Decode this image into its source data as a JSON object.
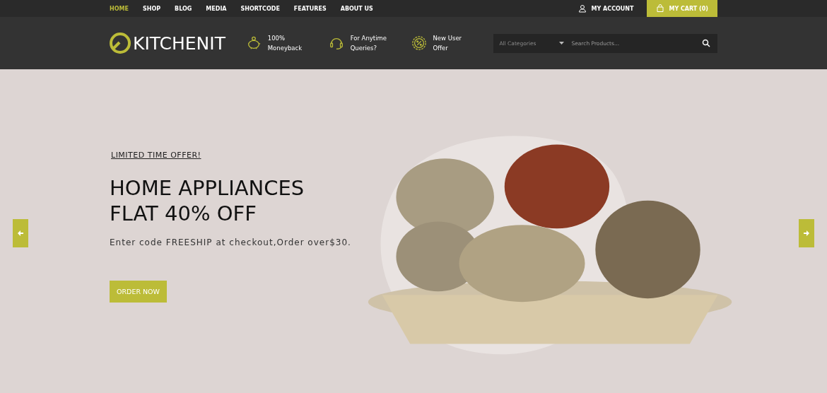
{
  "nav": [
    {
      "label": "HOME",
      "selected": true
    },
    {
      "label": "SHOP",
      "selected": false
    },
    {
      "label": "BLOG",
      "selected": false
    },
    {
      "label": "MEDIA",
      "selected": false
    },
    {
      "label": "SHORTCODE",
      "selected": false
    },
    {
      "label": "FEATURES",
      "selected": false
    },
    {
      "label": "ABOUT US",
      "selected": false
    }
  ],
  "account": "MY ACCOUNT",
  "cart": {
    "label": "MY CART",
    "count": "(0)"
  },
  "logo": "KITCHENIT",
  "features": [
    {
      "kind": "money",
      "line1": "100%",
      "line2": "Moneyback"
    },
    {
      "kind": "support",
      "line1": "For Anytime",
      "line2": "Queries?"
    },
    {
      "kind": "offer",
      "line1": "New User",
      "line2": "Offer"
    }
  ],
  "search": {
    "category": "All Categories",
    "placeholder": "Search Products..."
  },
  "hero": {
    "eyebrow": "LIMITED TIME OFFER!",
    "title_lines": [
      "HOME APPLIANCES",
      "FLAT 40% OFF"
    ],
    "text": "Enter code FREESHIP at checkout,Order over$30.",
    "button": "ORDER NOW"
  }
}
